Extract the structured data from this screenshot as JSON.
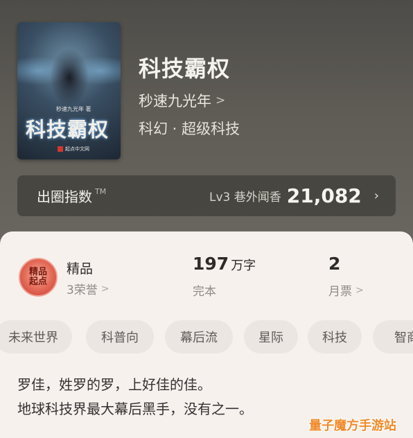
{
  "book": {
    "title": "科技霸权",
    "author": "秒速九光年",
    "genre": "科幻 · 超级科技",
    "cover": {
      "title": "科技霸权",
      "author_line": "秒速九光年 著",
      "publisher": "起点中文网"
    }
  },
  "circle": {
    "label": "出圈指数",
    "tm": "TM",
    "level": "Lv3 巷外闻香",
    "value": "21,082"
  },
  "stats": {
    "badge_text": "精品\n起点",
    "quality": {
      "label": "精品",
      "sub": "3荣誉"
    },
    "words": {
      "value": "197",
      "unit": "万字",
      "sub": "完本"
    },
    "tickets": {
      "value": "2",
      "sub": "月票"
    }
  },
  "tags": [
    "未来世界",
    "科普向",
    "幕后流",
    "星际",
    "科技",
    "智商"
  ],
  "description": {
    "line1": "罗佳，姓罗的罗，上好佳的佳。",
    "line2": "地球科技界最大幕后黑手，没有之一。"
  },
  "watermark": "量子魔方手游站",
  "icons": {
    "chevron": "chevron-right-icon"
  },
  "colors": {
    "card_bg": "#f7f1ee",
    "tag_bg": "#ece6e3",
    "top_bg": "#5d5a54"
  }
}
